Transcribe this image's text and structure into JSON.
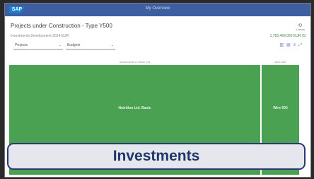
{
  "shell": {
    "title": "My Overview"
  },
  "header": {
    "title": "Projects under Construction - Type Y500",
    "subtitle": "Investments Development 2014 EUR",
    "count_icon": "⟲",
    "count_label": "1 items",
    "right_info": "1,783,469,055 EUR (1)"
  },
  "filters": {
    "select1": "Projects",
    "select2": "Budgets"
  },
  "toolbar": {
    "icons": [
      "bar-chart-icon",
      "table-icon",
      "menu-icon",
      "zoom-icon"
    ]
  },
  "chart_data": {
    "type": "treemap",
    "categories": [
      "Nutrition Ltd. Basic",
      "Wire 500"
    ],
    "values": [
      87,
      13
    ],
    "labels": [
      "Nutrition Ltd. Basic",
      "Wire 500"
    ],
    "column_headers": [
      "Investments in Work (%)",
      "Wire 500"
    ],
    "color": "#4aa152"
  },
  "caption": {
    "text": "Investments"
  }
}
